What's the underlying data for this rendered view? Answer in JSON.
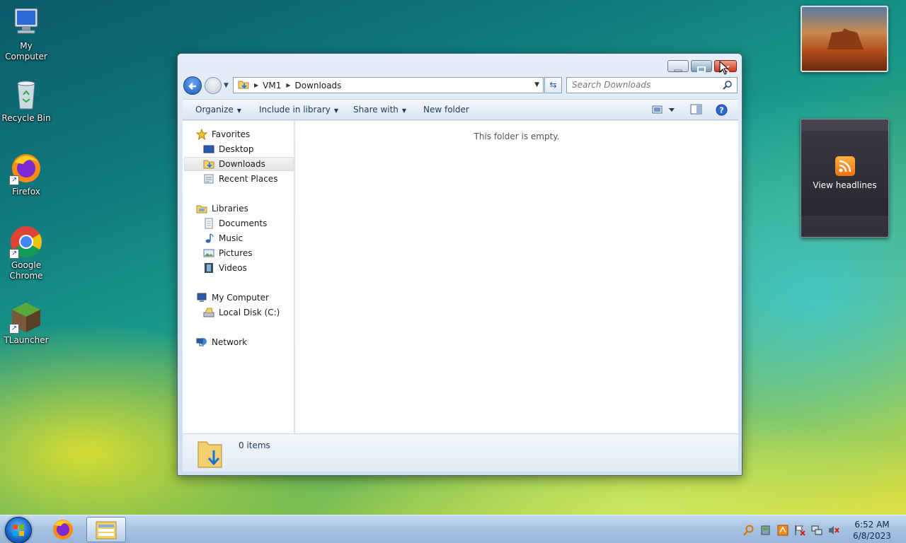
{
  "desktop": {
    "icons": [
      {
        "label_line1": "My",
        "label_line2": "Computer"
      },
      {
        "label_line1": "Recycle Bin",
        "label_line2": ""
      },
      {
        "label_line1": "Firefox",
        "label_line2": ""
      },
      {
        "label_line1": "Google",
        "label_line2": "Chrome"
      },
      {
        "label_line1": "TLauncher",
        "label_line2": ""
      }
    ]
  },
  "gadgets": {
    "rss": {
      "label": "View headlines"
    }
  },
  "window": {
    "address": {
      "root": "VM1",
      "current": "Downloads"
    },
    "search_placeholder": "Search Downloads",
    "toolbar": {
      "organize": "Organize",
      "include_in_library": "Include in library",
      "share_with": "Share with",
      "new_folder": "New folder"
    },
    "nav": {
      "favorites": "Favorites",
      "desktop": "Desktop",
      "downloads": "Downloads",
      "recent_places": "Recent Places",
      "libraries": "Libraries",
      "documents": "Documents",
      "music": "Music",
      "pictures": "Pictures",
      "videos": "Videos",
      "my_computer": "My Computer",
      "local_disk": "Local Disk (C:)",
      "network": "Network"
    },
    "content": {
      "empty_message": "This folder is empty."
    },
    "details": {
      "count": "0 items"
    }
  },
  "taskbar": {
    "clock": {
      "time": "6:52 AM",
      "date": "6/8/2023"
    }
  },
  "colors": {
    "accent": "#1a58c0",
    "close_button": "#c83820",
    "rss": "#f07010"
  }
}
